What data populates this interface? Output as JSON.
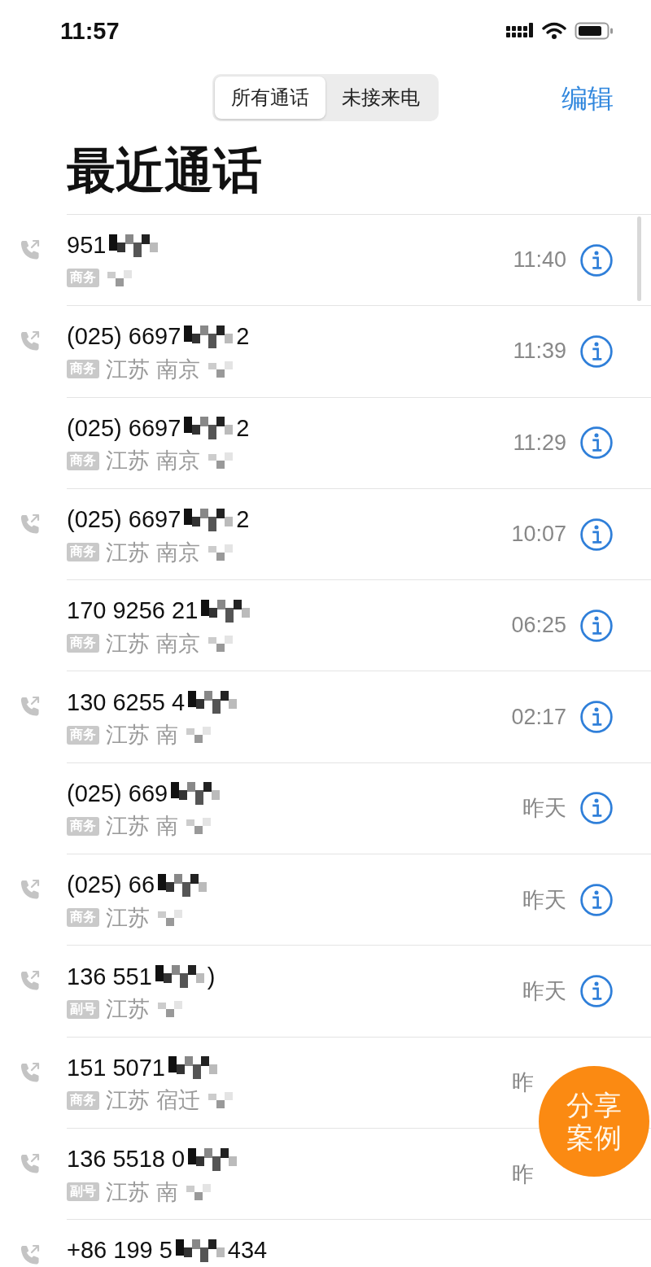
{
  "status_bar": {
    "time": "11:57"
  },
  "segments": [
    {
      "label": "所有通话",
      "selected": true
    },
    {
      "label": "未接来电",
      "selected": false
    }
  ],
  "edit_button": "编辑",
  "title": "最近通话",
  "calls": [
    {
      "outgoing": true,
      "number": "951",
      "tag": "商务",
      "time": "11:40",
      "info": true
    },
    {
      "outgoing": true,
      "number": "(025) 6697",
      "number_end": "2",
      "tag": "商务",
      "location": "江苏 南京",
      "time": "11:39",
      "info": true
    },
    {
      "outgoing": false,
      "number": "(025) 6697",
      "number_end": "2",
      "tag": "商务",
      "location": "江苏 南京",
      "time": "11:29",
      "info": true
    },
    {
      "outgoing": true,
      "number": "(025) 6697",
      "number_end": "2",
      "tag": "商务",
      "location": "江苏 南京",
      "time": "10:07",
      "info": true
    },
    {
      "outgoing": false,
      "number": "170 9256 21",
      "tag": "商务",
      "location": "江苏 南京",
      "time": "06:25",
      "info": true
    },
    {
      "outgoing": true,
      "number": "130 6255 4",
      "tag": "商务",
      "location": "江苏 南",
      "time": "02:17",
      "info": true
    },
    {
      "outgoing": false,
      "number": "(025) 669",
      "tag": "商务",
      "location": "江苏 南",
      "time": "昨天",
      "info": true
    },
    {
      "outgoing": true,
      "number": "(025) 66",
      "tag": "商务",
      "location": "江苏",
      "time": "昨天",
      "info": true
    },
    {
      "outgoing": true,
      "number": "136 551",
      "number_end": ")",
      "tag": "副号",
      "location": "江苏",
      "time": "昨天",
      "info": true
    },
    {
      "outgoing": true,
      "number": "151 5071",
      "tag": "商务",
      "location": "江苏 宿迁",
      "time": "昨",
      "info": false
    },
    {
      "outgoing": true,
      "number": "136 5518 0",
      "tag": "副号",
      "location": "江苏 南",
      "time": "昨",
      "info": false
    },
    {
      "outgoing": true,
      "number": "+86 199 5",
      "number_end": "434",
      "info": false
    }
  ],
  "share_button": "分享案例"
}
